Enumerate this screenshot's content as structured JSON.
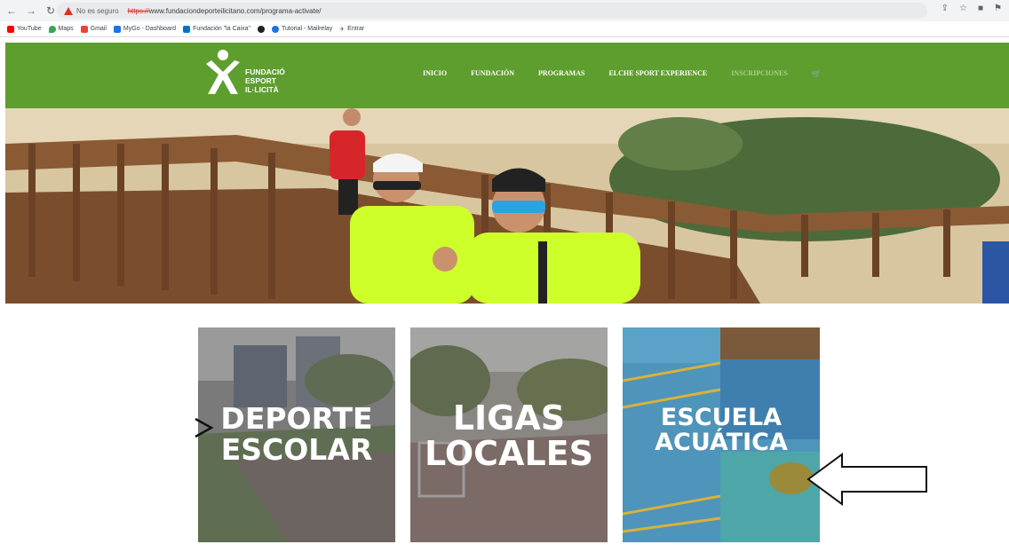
{
  "browser": {
    "security_label": "No es seguro",
    "url_scheme": "https://",
    "url_rest": "www.fundaciondeporteilicitano.com/programa-activate/",
    "bookmarks": [
      {
        "label": "YouTube",
        "icon": "youtube-icon",
        "color": "#ff0000"
      },
      {
        "label": "Maps",
        "icon": "maps-icon",
        "color": "#34a853"
      },
      {
        "label": "Gmail",
        "icon": "gmail-icon",
        "color": "#ea4335"
      },
      {
        "label": "MyGo - Dashboard",
        "icon": "dashboard-icon",
        "color": "#1a73e8"
      },
      {
        "label": "Fundación \"la Caixa\"",
        "icon": "caixa-icon",
        "color": "#0072ce"
      },
      {
        "label": "",
        "icon": "globe-icon",
        "color": "#202124"
      },
      {
        "label": "Tutorial - Mailrelay",
        "icon": "mailrelay-icon",
        "color": "#1a73e8"
      },
      {
        "label": "Entrar",
        "icon": "entrar-icon",
        "color": "#5f6368"
      }
    ]
  },
  "site": {
    "brand_color": "#5e9e2e",
    "logo_text": "FUNDACIÓ\nESPORT\nIL·LICITÀ",
    "menu": [
      {
        "label": "INICIO",
        "dim": false
      },
      {
        "label": "FUNDACIÓN",
        "dim": false
      },
      {
        "label": "PROGRAMAS",
        "dim": false
      },
      {
        "label": "ELCHE SPORT EXPERIENCE",
        "dim": false
      },
      {
        "label": "INSCRIPCIONES",
        "dim": true
      }
    ]
  },
  "cards": [
    {
      "line1": "DEPORTE",
      "line2": "ESCOLAR"
    },
    {
      "line1": "LIGAS",
      "line2": "LOCALES"
    },
    {
      "line1": "ESCUELA",
      "line2": "ACUÁTICA"
    }
  ]
}
